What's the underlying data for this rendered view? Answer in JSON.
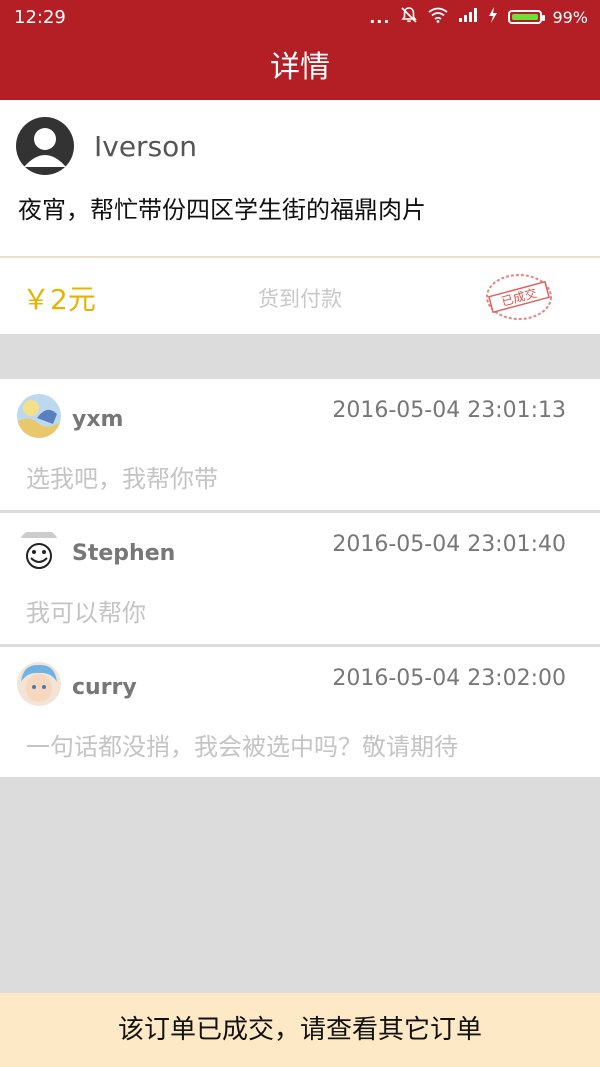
{
  "status_bar": {
    "time": "12:29",
    "dots": "...",
    "battery_percent": "99%",
    "battery_level": 0.99,
    "icons": [
      "dots-icon",
      "mute-bell-icon",
      "wifi-icon",
      "signal-icon",
      "charging-icon",
      "battery-icon"
    ]
  },
  "header": {
    "title": "详情"
  },
  "post": {
    "author": "Iverson",
    "text": "夜宵，帮忙带份四区学生街的福鼎肉片",
    "price": "￥2元",
    "payment": "货到付款",
    "stamp_text": "已成交",
    "colors": {
      "price": "#e6b400",
      "stamp": "#d9534f"
    }
  },
  "comments": [
    {
      "name": "yxm",
      "time": "2016-05-04 23:01:13",
      "text": "选我吧，我帮你带"
    },
    {
      "name": "Stephen",
      "time": "2016-05-04 23:01:40",
      "text": "我可以帮你"
    },
    {
      "name": "curry",
      "time": "2016-05-04 23:02:00",
      "text": "一句话都没捎，我会被选中吗？敬请期待"
    }
  ],
  "footer": {
    "message": "该订单已成交，请查看其它订单"
  },
  "colors": {
    "brand": "#b31f24",
    "background": "#dcdcdc",
    "footer_bg": "#fde9c5"
  }
}
